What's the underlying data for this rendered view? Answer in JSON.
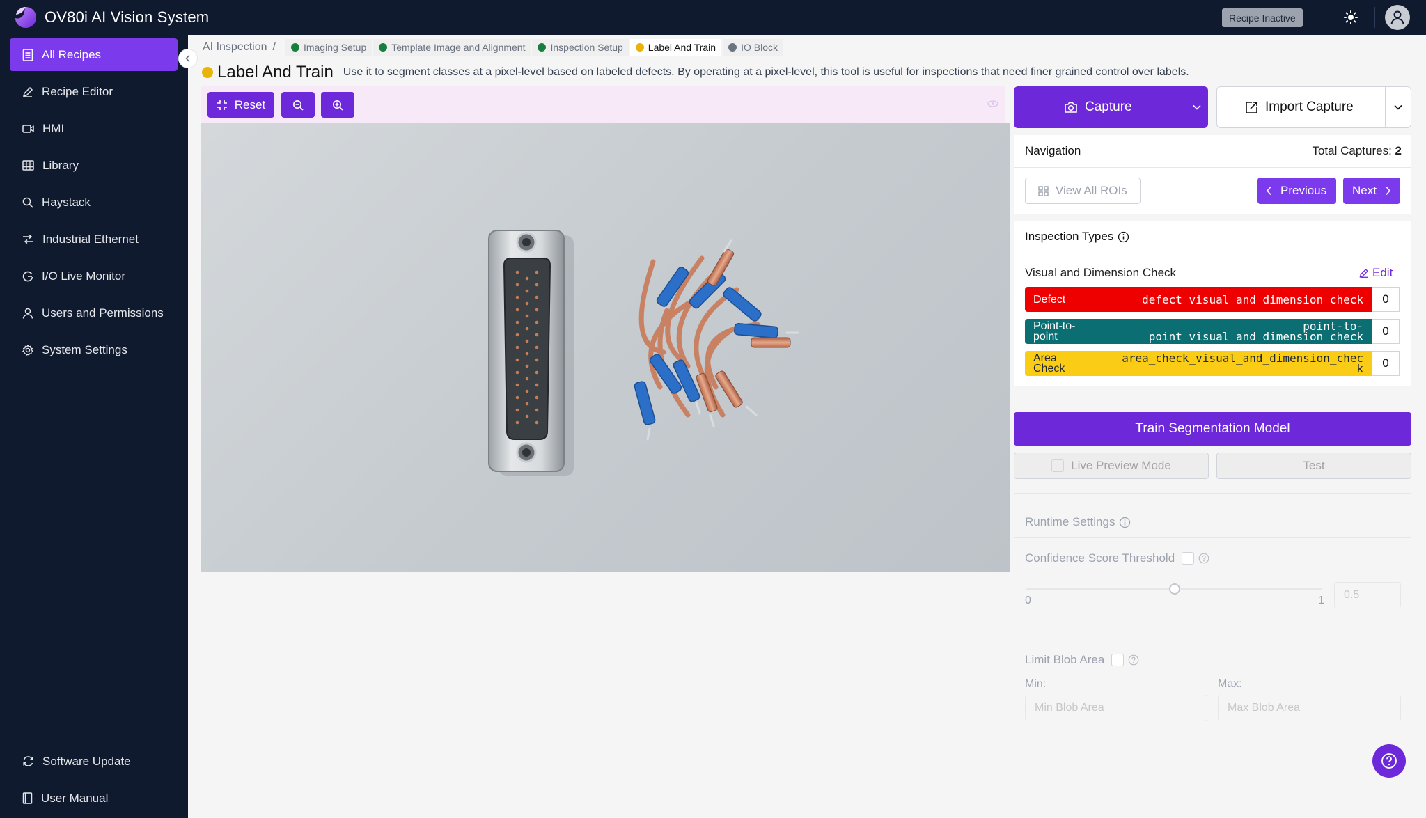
{
  "app": {
    "title": "OV80i AI Vision System",
    "recipe_status": "Recipe Inactive"
  },
  "sidebar": {
    "items": [
      {
        "label": "All Recipes",
        "icon": "document-list-icon",
        "active": true
      },
      {
        "label": "Recipe Editor",
        "icon": "pencil-icon"
      },
      {
        "label": "HMI",
        "icon": "video-icon"
      },
      {
        "label": "Library",
        "icon": "table-icon"
      },
      {
        "label": "Haystack",
        "icon": "search-icon"
      },
      {
        "label": "Industrial Ethernet",
        "icon": "ethernet-icon"
      },
      {
        "label": "I/O Live Monitor",
        "icon": "monitor-icon"
      },
      {
        "label": "Users and Permissions",
        "icon": "user-icon"
      },
      {
        "label": "System Settings",
        "icon": "gear-icon"
      }
    ],
    "bottom": [
      {
        "label": "Software Update",
        "icon": "refresh-icon"
      },
      {
        "label": "User Manual",
        "icon": "book-icon"
      }
    ]
  },
  "breadcrumb": {
    "root": "AI Inspection",
    "sep": "/",
    "steps": [
      {
        "label": "Imaging Setup",
        "status_color": "#15803d"
      },
      {
        "label": "Template Image and Alignment",
        "status_color": "#15803d"
      },
      {
        "label": "Inspection Setup",
        "status_color": "#15803d"
      },
      {
        "label": "Label And Train",
        "status_color": "#eab308"
      },
      {
        "label": "IO Block",
        "status_color": "#6b7280"
      }
    ]
  },
  "page": {
    "title": "Label And Train",
    "description": "Use it to segment classes at a pixel-level based on labeled defects. By operating at a pixel-level, this tool is useful for inspections that need finer grained control over labels."
  },
  "toolbar": {
    "reset_label": "Reset"
  },
  "capture": {
    "capture_label": "Capture",
    "import_label": "Import Capture"
  },
  "navigation": {
    "title": "Navigation",
    "total_label": "Total Captures:",
    "total_value": "2",
    "view_all_label": "View All ROIs",
    "previous_label": "Previous",
    "next_label": "Next"
  },
  "inspection_types": {
    "title": "Inspection Types",
    "group_name": "Visual and Dimension Check",
    "edit_label": "Edit",
    "rows": [
      {
        "name": "Defect",
        "key": "defect_visual_and_dimension_check",
        "count": "0",
        "bg": "#ef0000",
        "fg": "#ffffff"
      },
      {
        "name_1": "Point-to-",
        "name_2": "point",
        "key_1": "point-to-",
        "key_2": "point_visual_and_dimension_check",
        "count": "0",
        "bg": "#0b6e73",
        "fg": "#ffffff"
      },
      {
        "name_1": "Area",
        "name_2": "Check",
        "key_1": "area_check_visual_and_dimension_chec",
        "key_2": "k",
        "count": "0",
        "bg": "#facc15",
        "fg": "#1f2937"
      }
    ]
  },
  "train": {
    "train_label": "Train Segmentation Model",
    "live_preview_label": "Live Preview Mode",
    "test_label": "Test"
  },
  "runtime": {
    "title": "Runtime Settings",
    "confidence_label": "Confidence Score Threshold",
    "slider_min": "0",
    "slider_max": "1",
    "slider_value": 0.5,
    "slider_value_text": "0.5",
    "limit_blob_label": "Limit Blob Area",
    "min_label": "Min:",
    "max_label": "Max:",
    "min_placeholder": "Min Blob Area",
    "max_placeholder": "Max Blob Area"
  },
  "colors": {
    "accent": "#6d28d9",
    "nav_bg": "#0f1a2e"
  }
}
